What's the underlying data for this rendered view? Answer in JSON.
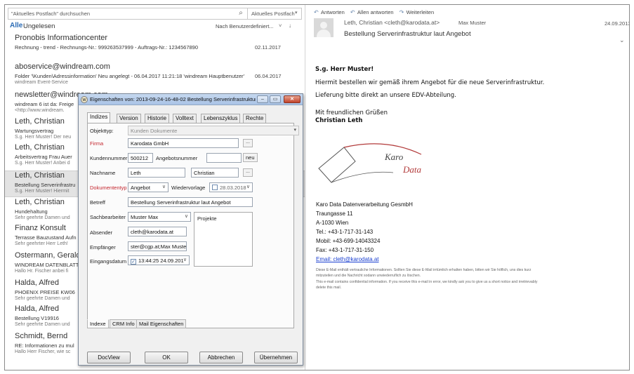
{
  "search": {
    "placeholder": "\"Aktuelles Postfach\" durchsuchen",
    "scope": "Aktuelles Postfach"
  },
  "filter": {
    "all": "Alle",
    "unread": "Ungelesen",
    "sort": "Nach Benutzerdefiniert...",
    "sort_arrow": "˅",
    "sort_dir": "↓"
  },
  "mails": [
    {
      "sender": "Pronobis Informationcenter",
      "subject": "Rechnung - trend - Rechnungs-Nr.: 999263537999 - Auftrags-Nr.: 1234567890",
      "preview": "",
      "date": "02.11.2017"
    },
    {
      "sender": "aboservice@windream.com",
      "subject": "Folder '\\Kunden\\Adressinformation' Neu angelegt - 06.04.2017 11:21:18 'windream Hauptbenutzer'",
      "preview": "windream Event-Service",
      "date": "06.04.2017"
    },
    {
      "sender": "newsletter@windream.com",
      "subject": "windream 6 ist da: Freige",
      "preview": "<http://www.windream.",
      "date": ""
    },
    {
      "sender": "Leth, Christian",
      "subject": "Wartungsvertrag",
      "preview": "S.g. Herr Muster!  Der neu",
      "date": ""
    },
    {
      "sender": "Leth, Christian",
      "subject": "Arbeitsvertrag Frau Auer",
      "preview": "S.g. Herr Muster!  Anbei d",
      "date": ""
    },
    {
      "sender": "Leth, Christian",
      "subject": "Bestellung Serverinfrastru",
      "preview": "S.g. Herr Muster!  Hiermit",
      "date": ""
    },
    {
      "sender": "Leth, Christian",
      "subject": "Hundehaltung",
      "preview": "Sehr geehrte Damen und",
      "date": ""
    },
    {
      "sender": "Finanz Konsult",
      "subject": "Terrasse Bauzustand Aufn",
      "preview": "Sehr geehrter Herr Leth!",
      "date": ""
    },
    {
      "sender": "Ostermann, Gerald",
      "subject": "WINDREAM DATENBLATT",
      "preview": "Hallo Hr. Fischer  anbei fi",
      "date": ""
    },
    {
      "sender": "Halda, Alfred",
      "subject": "PHOENIX PREISE KW06",
      "preview": "Sehr geehrte Damen und",
      "date": ""
    },
    {
      "sender": "Halda, Alfred",
      "subject": "Bestellung V19916",
      "preview": "Sehr geehrte Damen und",
      "date": ""
    },
    {
      "sender": "Schmidt, Bernd",
      "subject": "RE: Informationen zu mul",
      "preview": "Hallo Herr Fischer,  wie sc",
      "date": ""
    }
  ],
  "reading": {
    "actions": [
      "Antworten",
      "Allen antworten",
      "Weiterleiten"
    ],
    "from": "Leth, Christian <cleth@karodata.at>",
    "to": "Max Muster",
    "date": "24.09.2013",
    "subject": "Bestellung Serverinfrastruktur laut Angebot",
    "greeting": "S.g. Herr Muster!",
    "line1": "Hiermit bestellen wir gemäß ihrem Angebot für die neue Serverinfrastruktur.",
    "line2": "Lieferung bitte direkt an unsere EDV-Abteilung.",
    "closing1": "Mit freundlichen Grüßen",
    "closing2": "Christian Leth",
    "logo_text1": "Karo",
    "logo_text2": "Data",
    "sig": [
      "Karo Data Datenverarbeitung GesmbH",
      "Traungasse 11",
      "A-1030 Wien",
      "Tel.: +43-1-717-31-143",
      "Mobil: +43-699-14043324",
      "Fax: +43-1-717-31-150"
    ],
    "sig_email": "Email: cleth@karodata.at",
    "disclaimer": [
      "Diese E-Mail enthält vertrauliche Informationen. Sollten Sie diese E-Mail irrtümlich erhalten haben, bitten wir Sie höflich, uns dies kurz",
      "mitzuteilen und die Nachricht sodann unwiederruflich zu löschen.",
      "This e-mail contains confidential information. If you receive this e-mail in error, we kindly ask you to give us a short notice and irretrievably",
      "delete this mail."
    ]
  },
  "dialog": {
    "title": "Eigenschaften von: 2013-09-24-16-48-02 Bestellung Serverinfrastruktur laut Ar",
    "tabs": [
      "Indizes",
      "Version",
      "Historie",
      "Volltext",
      "Lebenszyklus",
      "Rechte"
    ],
    "objekttyp_label": "Objekttyp:",
    "objekttyp_value": "Kunden Dokumente",
    "firma_label": "Firma",
    "firma_value": "Karodata GmbH",
    "kundennummer_label": "Kundennummer",
    "kundennummer_value": "500212",
    "angebotsnummer_label": "Angebotsnummer",
    "angebotsnummer_value": "",
    "neu_label": "neu",
    "nachname_label": "Nachname",
    "nachname_value": "Leth",
    "vorname_value": "Christian",
    "dokumententyp_label": "Dokumententyp",
    "dokumententyp_value": "Angebot",
    "wiedervorlage_label": "Wiedervorlage",
    "wiedervorlage_value": "28.03.2018",
    "betreff_label": "Betreff",
    "betreff_value": "Bestellung Serverinfrastruktur laut Angebot",
    "sachbearbeiter_label": "Sachbearbeiter",
    "sachbearbeiter_value": "Muster Max",
    "projekte_label": "Projekte",
    "absender_label": "Absender",
    "absender_value": "cleth@karodata.at",
    "empfaenger_label": "Empfänger",
    "empfaenger_value": "ster@cgp.at;Max Muster",
    "eingangsdatum_label": "Eingangsdatum",
    "eingangsdatum_value": "13:44:25 24.09.201",
    "dots": "...",
    "bottom_tabs": [
      "Indexe",
      "CRM Info",
      "Mail Eigenschaften"
    ],
    "buttons": {
      "docview": "DocView",
      "ok": "OK",
      "cancel": "Abbrechen",
      "apply": "Übernehmen"
    }
  }
}
